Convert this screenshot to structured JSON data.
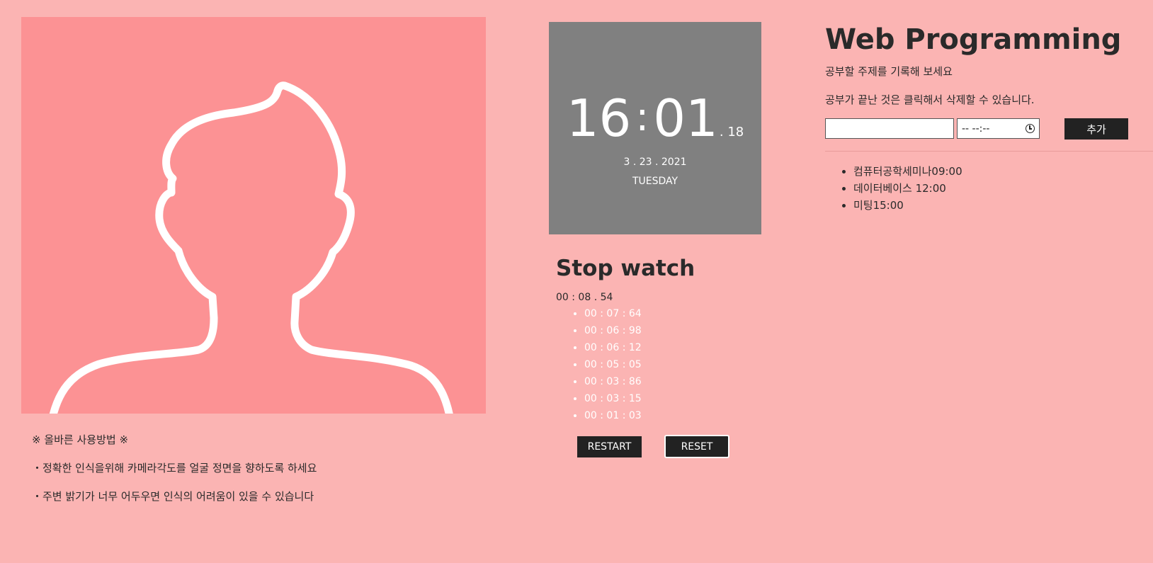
{
  "camera": {
    "background_color": "#fc9294",
    "outline_color": "#ffffff"
  },
  "guide": {
    "heading": "※ 올바른 사용방법 ※",
    "tips": [
      "・정확한 인식을위해 카메라각도를 얼굴 정면을 향하도록 하세요",
      "・주변 밝기가 너무 어두우면 인식의 어려움이 있을 수 있습니다"
    ]
  },
  "clock": {
    "hours": "16",
    "separator": ":",
    "minutes": "01",
    "seconds": ". 18",
    "date": "3 . 23 . 2021",
    "day": "TUESDAY",
    "background_color": "#808080"
  },
  "stopwatch": {
    "title": "Stop watch",
    "current": "00 : 08 . 54",
    "laps": [
      "00 : 07 : 64",
      "00 : 06 : 98",
      "00 : 06 : 12",
      "00 : 05 : 05",
      "00 : 03 : 86",
      "00 : 03 : 15",
      "00 : 01 : 03"
    ],
    "restart_label": "RESTART",
    "reset_label": "RESET"
  },
  "todo": {
    "title": "Web Programming",
    "subtitle": "공부할 주제를 기록해 보세요",
    "instruction": "공부가 끝난 것은 클릭해서 삭제할 수 있습니다.",
    "topic_value": "",
    "time_value": "-- --:--",
    "add_label": "추가",
    "items": [
      "컴퓨터공학세미나09:00",
      "데이터베이스 12:00",
      "미팅15:00"
    ]
  },
  "colors": {
    "page_background": "#fbb4b3",
    "button_background": "#222222"
  }
}
